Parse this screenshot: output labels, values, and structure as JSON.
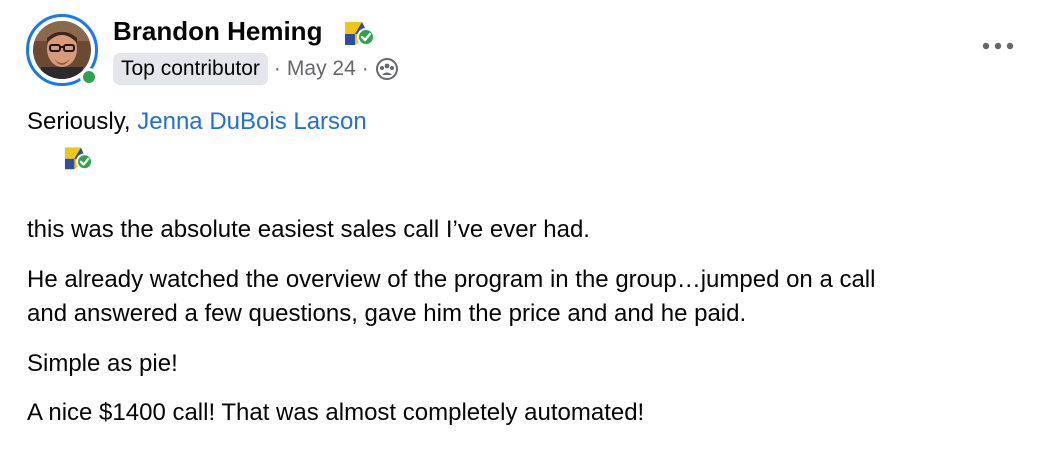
{
  "post": {
    "author": {
      "name": "Brandon Heming",
      "badge": "Top contributor",
      "date": "May 24",
      "online": true,
      "badge_icon": "verified-group-icon",
      "audience_icon": "group-audience-icon"
    },
    "menu_icon": "more-horizontal-icon",
    "text": {
      "intro": "Seriously, ",
      "mention": "Jenna DuBois Larson",
      "para1": " this was the absolute easiest sales call I’ve ever had.",
      "para2_line1": "He already watched the overview of the program in the group…jumped on a call",
      "para2_line2": "and answered a few questions, gave him the price and and he paid.",
      "para3": "Simple as pie!",
      "para4": "A nice $1400 call! That was almost completely automated!"
    }
  },
  "colors": {
    "link": "#216fdb",
    "online": "#31a24c",
    "ring": "#1877f2",
    "secondary_text": "#65676b"
  }
}
